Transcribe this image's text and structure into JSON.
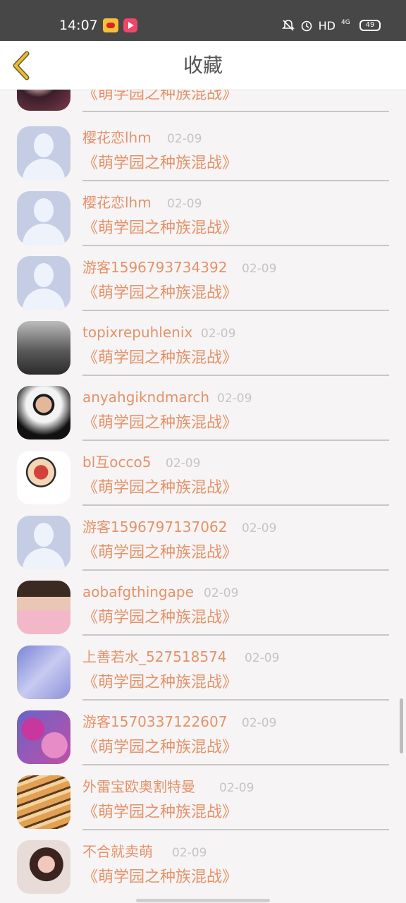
{
  "status_bar": {
    "time": "14:07",
    "network": "HD",
    "signal": "4G",
    "battery": "49"
  },
  "header": {
    "title": "收藏"
  },
  "items": [
    {
      "name": "",
      "date": "",
      "content": "《萌学园之种族混战》",
      "avatar": "photo-partial"
    },
    {
      "name": "樱花恋lhm",
      "date": "02-09",
      "content": "《萌学园之种族混战》",
      "avatar": "default"
    },
    {
      "name": "樱花恋lhm",
      "date": "02-09",
      "content": "《萌学园之种族混战》",
      "avatar": "default"
    },
    {
      "name": "游客1596793734392",
      "date": "02-09",
      "content": "《萌学园之种族混战》",
      "avatar": "default"
    },
    {
      "name": "topixrepuhlenix",
      "date": "02-09",
      "content": "《萌学园之种族混战》",
      "avatar": "photo-bw"
    },
    {
      "name": "anyahgikndmarch",
      "date": "02-09",
      "content": "《萌学园之种族混战》",
      "avatar": "photo-sunglasses"
    },
    {
      "name": "bl互occo5",
      "date": "02-09",
      "content": "《萌学园之种族混战》",
      "avatar": "cartoon"
    },
    {
      "name": "游客1596797137062",
      "date": "02-09",
      "content": "《萌学园之种族混战》",
      "avatar": "default"
    },
    {
      "name": "aobafgthingape",
      "date": "02-09",
      "content": "《萌学园之种族混战》",
      "avatar": "photo-mirror"
    },
    {
      "name": "上善若水_527518574",
      "date": "02-09",
      "content": "《萌学园之种族混战》",
      "avatar": "photo-blue"
    },
    {
      "name": "游客1570337122607",
      "date": "02-09",
      "content": "《萌学园之种族混战》",
      "avatar": "photo-flowers"
    },
    {
      "name": "外雷宝欧奥割特曼",
      "date": "02-09",
      "content": "《萌学园之种族混战》",
      "avatar": "photo-tiger"
    },
    {
      "name": "不合就卖萌",
      "date": "02-09",
      "content": "《萌学园之种族混战》",
      "avatar": "photo-girl"
    }
  ],
  "colors": {
    "accent": "#e4926a",
    "date": "#c9c3c3",
    "back_icon": "#e8bd2f",
    "status_bar": "#474747"
  }
}
